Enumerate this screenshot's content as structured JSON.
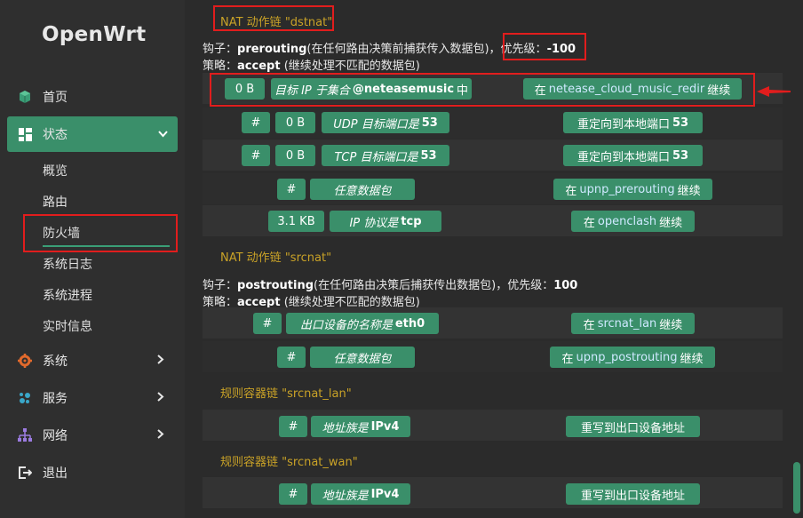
{
  "sidebar": {
    "logo": "OpenWrt",
    "items": [
      {
        "label": "首页",
        "icon": "cube-icon"
      },
      {
        "label": "状态",
        "icon": "dashboard-icon"
      },
      {
        "label": "系统",
        "icon": "gear-icon"
      },
      {
        "label": "服务",
        "icon": "puzzle-icon"
      },
      {
        "label": "网络",
        "icon": "network-icon"
      },
      {
        "label": "退出",
        "icon": "logout-icon"
      }
    ],
    "status_sub": [
      "概览",
      "路由",
      "防火墙",
      "系统日志",
      "系统进程",
      "实时信息"
    ],
    "active_item": "状态",
    "active_sub": "防火墙"
  },
  "main": {
    "dstnat": {
      "heading": "NAT 动作链 \"dstnat\"",
      "hook_prefix": "钩子：",
      "hook_name": "prerouting",
      "hook_desc": "(在任何路由决策前捕获传入数据包)，",
      "priority_label": "优先级：",
      "priority_value": "-100",
      "policy_prefix": "策略：",
      "policy_name": "accept",
      "policy_desc": "(继续处理不匹配的数据包)",
      "rules": [
        {
          "counter": "0 B",
          "match_prefix": "目标 IP 于集合",
          "match_value": "@neteasemusic",
          "match_suffix": "中",
          "action_prefix": "在",
          "action_link": "netease_cloud_music_redir",
          "action_suffix": "继续"
        },
        {
          "hash": "#",
          "counter": "0 B",
          "match_prefix": "UDP 目标端口是",
          "match_value": "53",
          "action": "重定向到本地端口",
          "action_value": "53"
        },
        {
          "hash": "#",
          "counter": "0 B",
          "match_prefix": "TCP 目标端口是",
          "match_value": "53",
          "action": "重定向到本地端口",
          "action_value": "53"
        },
        {
          "hash": "#",
          "match_prefix": "任意数据包",
          "action_prefix": "在",
          "action_link": "upnp_prerouting",
          "action_suffix": "继续"
        },
        {
          "counter": "3.1 KB",
          "match_prefix": "IP 协议是",
          "match_value": "tcp",
          "action_prefix": "在",
          "action_link": "openclash",
          "action_suffix": "继续"
        }
      ]
    },
    "srcnat": {
      "heading": "NAT 动作链 \"srcnat\"",
      "hook_prefix": "钩子：",
      "hook_name": "postrouting",
      "hook_desc": "(在任何路由决策后捕获传出数据包)，优先级：",
      "priority_value": "100",
      "policy_prefix": "策略：",
      "policy_name": "accept",
      "policy_desc": "(继续处理不匹配的数据包)",
      "rules": [
        {
          "hash": "#",
          "match_prefix": "出口设备的名称是",
          "match_value": "eth0",
          "action_prefix": "在",
          "action_link": "srcnat_lan",
          "action_suffix": "继续"
        },
        {
          "hash": "#",
          "match_prefix": "任意数据包",
          "action_prefix": "在",
          "action_link": "upnp_postrouting",
          "action_suffix": "继续"
        }
      ]
    },
    "srcnat_lan": {
      "heading": "规则容器链 \"srcnat_lan\"",
      "rules": [
        {
          "hash": "#",
          "match_prefix": "地址族是",
          "match_value": "IPv4",
          "action": "重写到出口设备地址"
        }
      ]
    },
    "srcnat_wan": {
      "heading": "规则容器链 \"srcnat_wan\"",
      "rules": [
        {
          "hash": "#",
          "match_prefix": "地址族是",
          "match_value": "IPv4",
          "action": "重写到出口设备地址"
        }
      ]
    }
  },
  "colors": {
    "accent": "#3a8f6a",
    "heading": "#c9a227",
    "highlight": "#e11d1d",
    "background": "#2b2b2b"
  }
}
